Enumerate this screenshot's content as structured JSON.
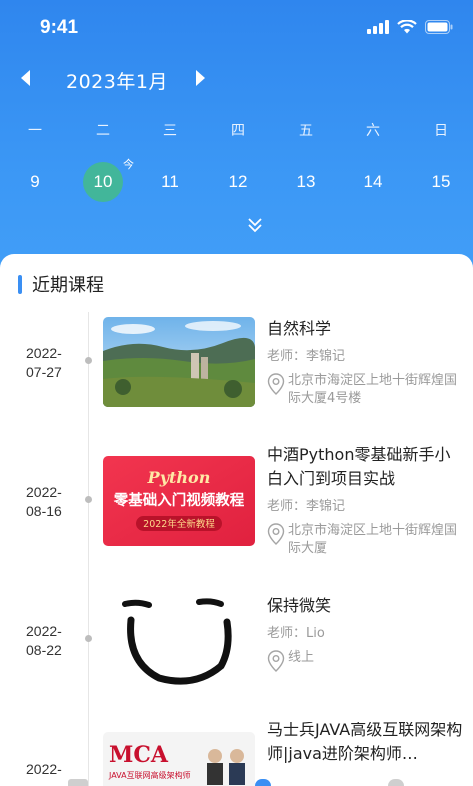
{
  "status": {
    "time": "9:41"
  },
  "calendar": {
    "month_label": "2023年1月",
    "weekdays": [
      "一",
      "二",
      "三",
      "四",
      "五",
      "六",
      "日"
    ],
    "dates": [
      "9",
      "10",
      "11",
      "12",
      "13",
      "14",
      "15"
    ],
    "selected_index": 1,
    "today_mark": "今",
    "selected_color": "#42b69a"
  },
  "section": {
    "title": "近期课程"
  },
  "courses": [
    {
      "date": "2022-\n07-27",
      "title": "自然科学",
      "teacher": "老师：李锦记",
      "location": "北京市海淀区上地十街辉煌国际大厦4号楼",
      "thumb_icon": "landscape-photo"
    },
    {
      "date": "2022-\n08-16",
      "title": "中酒Python零基础新手小白入门到项目实战",
      "teacher": "老师：李锦记",
      "location": "北京市海淀区上地十街辉煌国际大厦",
      "thumb_icon": "python-course-banner",
      "thumb_text": {
        "line1": "Python",
        "line2": "零基础入门视频教程",
        "line3": "2022年全新教程"
      }
    },
    {
      "date": "2022-\n08-22",
      "title": "保持微笑",
      "teacher": "老师：Lio",
      "location": "线上",
      "thumb_icon": "smiley-drawing"
    },
    {
      "date": "2022-",
      "title": "马士兵JAVA高级互联网架构师|java进阶架构师…",
      "thumb_icon": "java-course-banner",
      "thumb_text": {
        "line1": "MCA",
        "line2": "JAVA互联网高级架构师"
      }
    }
  ],
  "colors": {
    "header": "#3b97f5",
    "accent": "#3a8ff3"
  }
}
